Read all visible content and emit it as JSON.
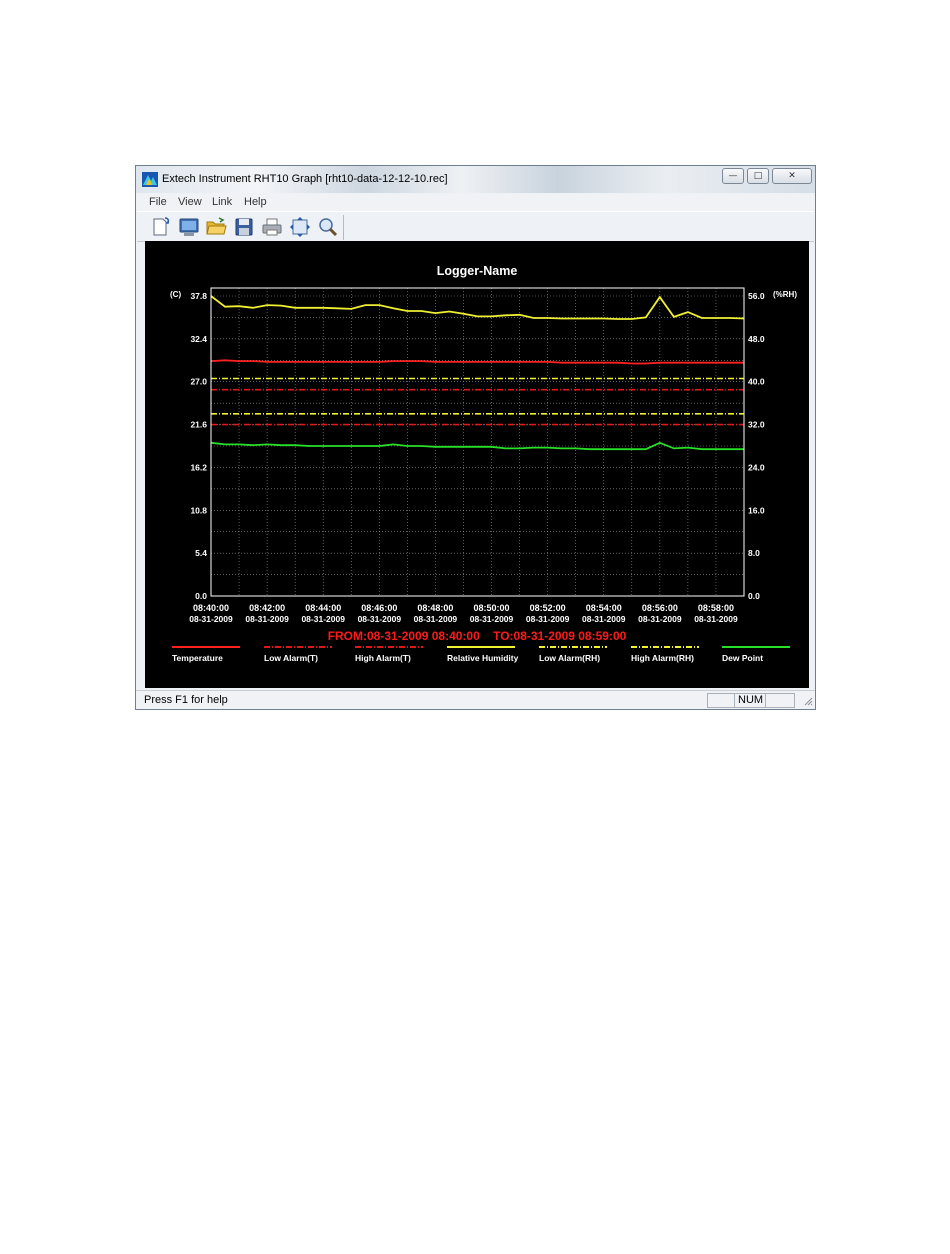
{
  "window": {
    "title": "Extech Instrument RHT10 Graph [rht10-data-12-12-10.rec]",
    "controls": {
      "minimize": "—",
      "maximize": "□",
      "close": "✕"
    }
  },
  "menu": [
    "File",
    "View",
    "Link",
    "Help"
  ],
  "toolbar": {
    "buttons": [
      "new-record-icon",
      "monitor-icon",
      "open-folder-icon",
      "save-icon",
      "print-icon",
      "zoom-fit-icon",
      "zoom-icon"
    ]
  },
  "status": {
    "help": "Press F1 for help",
    "num": "NUM"
  },
  "chart_data": {
    "type": "line",
    "title": "Logger-Name",
    "left_axis": {
      "unit": "(C)",
      "ticks": [
        "0.0",
        "5.4",
        "10.8",
        "16.2",
        "21.6",
        "27.0",
        "32.4",
        "37.8"
      ],
      "range": [
        0,
        37.8
      ]
    },
    "right_axis": {
      "unit": "(%RH)",
      "ticks": [
        "0.0",
        "8.0",
        "16.0",
        "24.0",
        "32.0",
        "40.0",
        "48.0",
        "56.0"
      ],
      "range": [
        0,
        56.0
      ]
    },
    "x_ticks": [
      {
        "time": "08:40:00",
        "date": "08-31-2009"
      },
      {
        "time": "08:42:00",
        "date": "08-31-2009"
      },
      {
        "time": "08:44:00",
        "date": "08-31-2009"
      },
      {
        "time": "08:46:00",
        "date": "08-31-2009"
      },
      {
        "time": "08:48:00",
        "date": "08-31-2009"
      },
      {
        "time": "08:50:00",
        "date": "08-31-2009"
      },
      {
        "time": "08:52:00",
        "date": "08-31-2009"
      },
      {
        "time": "08:54:00",
        "date": "08-31-2009"
      },
      {
        "time": "08:56:00",
        "date": "08-31-2009"
      },
      {
        "time": "08:58:00",
        "date": "08-31-2009"
      }
    ],
    "x_minutes": [
      0,
      0.5,
      1,
      1.5,
      2,
      2.5,
      3,
      3.5,
      4,
      4.5,
      5,
      5.5,
      6,
      6.5,
      7,
      7.5,
      8,
      8.5,
      9,
      9.5,
      10,
      10.5,
      11,
      11.5,
      12,
      12.5,
      13,
      13.5,
      14,
      14.5,
      15,
      15.5,
      16,
      16.5,
      17,
      17.5,
      18,
      18.5,
      19
    ],
    "range_label": "FROM:08-31-2009 08:40:00    TO:08-31-2009 08:59:00",
    "grid": true,
    "series": [
      {
        "name": "Temperature",
        "axis": "left",
        "color": "#ff2020",
        "style": "solid",
        "values": [
          29.6,
          29.7,
          29.6,
          29.6,
          29.5,
          29.5,
          29.5,
          29.5,
          29.5,
          29.5,
          29.5,
          29.5,
          29.5,
          29.6,
          29.6,
          29.6,
          29.5,
          29.5,
          29.5,
          29.5,
          29.5,
          29.5,
          29.5,
          29.5,
          29.5,
          29.4,
          29.4,
          29.4,
          29.4,
          29.4,
          29.3,
          29.3,
          29.4,
          29.4,
          29.4,
          29.4,
          29.4,
          29.4,
          29.4
        ]
      },
      {
        "name": "Low Alarm(T)",
        "axis": "left",
        "color": "#e01818",
        "style": "dashdot",
        "constant": 21.6
      },
      {
        "name": "High Alarm(T)",
        "axis": "left",
        "color": "#e01818",
        "style": "dashdot",
        "constant": 26.0
      },
      {
        "name": "Relative Humidity",
        "axis": "right",
        "color": "#f0f032",
        "style": "solid",
        "values": [
          56.0,
          54.0,
          54.1,
          53.8,
          54.3,
          54.2,
          53.8,
          53.8,
          53.8,
          53.7,
          53.6,
          54.3,
          54.3,
          53.7,
          53.2,
          53.2,
          52.8,
          53.1,
          52.7,
          52.2,
          52.2,
          52.4,
          52.5,
          51.9,
          51.9,
          51.8,
          51.8,
          51.8,
          51.8,
          51.7,
          51.7,
          52.0,
          55.8,
          52.1,
          53.0,
          51.9,
          51.9,
          51.9,
          51.8
        ]
      },
      {
        "name": "Low Alarm(RH)",
        "axis": "right",
        "color": "#f0f032",
        "style": "dashdot",
        "constant": 34.0
      },
      {
        "name": "High Alarm(RH)",
        "axis": "right",
        "color": "#f0f032",
        "style": "dashdot",
        "constant": 40.6
      },
      {
        "name": "Dew Point",
        "axis": "left",
        "color": "#28e028",
        "style": "solid",
        "values": [
          19.3,
          19.1,
          19.1,
          19.0,
          19.1,
          19.0,
          19.0,
          18.9,
          18.9,
          18.9,
          18.9,
          18.9,
          18.9,
          19.1,
          18.9,
          18.9,
          18.8,
          18.8,
          18.8,
          18.8,
          18.8,
          18.6,
          18.6,
          18.7,
          18.7,
          18.6,
          18.6,
          18.5,
          18.5,
          18.5,
          18.5,
          18.5,
          19.3,
          18.6,
          18.7,
          18.5,
          18.5,
          18.5,
          18.5
        ]
      }
    ]
  }
}
